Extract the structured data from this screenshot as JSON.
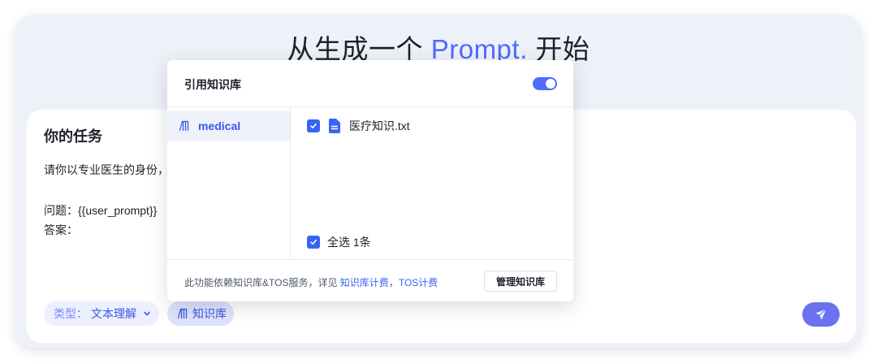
{
  "hero": {
    "title_prefix": "从生成一个 ",
    "title_accent": "Prompt.",
    "title_suffix": " 开始"
  },
  "task": {
    "heading": "你的任务",
    "line1": "请你以专业医生的身份，",
    "line2": "问题：{{user_prompt}}",
    "line3": "答案："
  },
  "toolbar": {
    "type_label": "类型：",
    "type_value": "文本理解",
    "kb_label": "知识库"
  },
  "popup": {
    "title": "引用知识库",
    "toggle_on": true,
    "knowledge_bases": [
      {
        "name": "medical"
      }
    ],
    "files": [
      {
        "name": "医疗知识.txt",
        "checked": true
      }
    ],
    "select_all": "全选 1条",
    "footer_text": "此功能依赖知识库&TOS服务，详见 ",
    "link_kb": "知识库计费",
    "separator": "，",
    "link_tos": "TOS计费",
    "manage_button": "管理知识库"
  },
  "colors": {
    "accent": "#4d6bfe",
    "send": "#6b72f0",
    "checkbox": "#3b63f3"
  },
  "icons": {
    "kb": "books-icon",
    "file": "document-icon",
    "send": "paper-plane-icon",
    "dropdown": "chevron-down-icon",
    "check": "check-icon"
  }
}
